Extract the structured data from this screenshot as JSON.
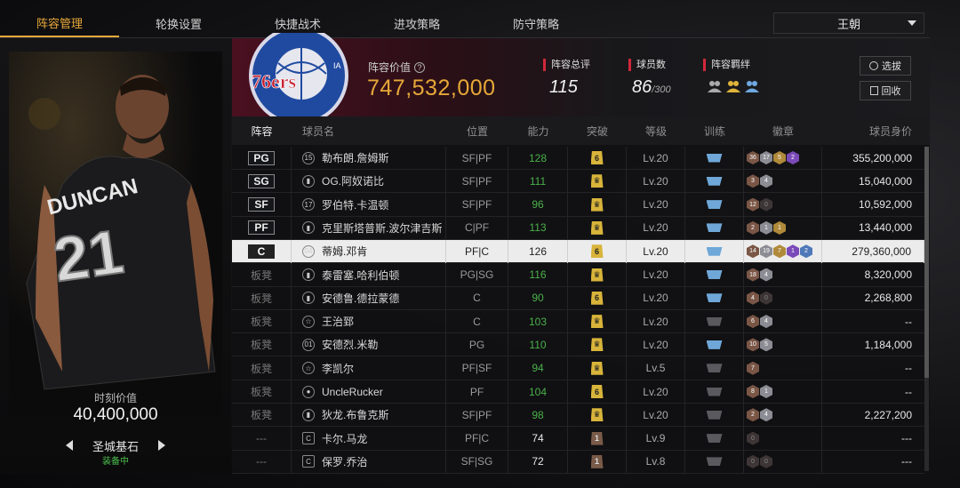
{
  "tabs": [
    {
      "label": "阵容管理",
      "active": true
    },
    {
      "label": "轮换设置",
      "active": false
    },
    {
      "label": "快捷战术",
      "active": false
    },
    {
      "label": "进攻策略",
      "active": false
    },
    {
      "label": "防守策略",
      "active": false
    }
  ],
  "team_select": {
    "value": "王朝"
  },
  "player_card": {
    "moment_label": "时刻价值",
    "moment_value": "40,400,000",
    "card_name": "圣城基石",
    "equipped": "装备中"
  },
  "summary": {
    "lineup_value_label": "阵容价值",
    "lineup_value": "747,532,000",
    "rating_label": "阵容总评",
    "rating": "115",
    "player_count_label": "球员数",
    "player_count": "86",
    "player_count_max": "/300",
    "bond_label": "阵容羁绊",
    "select_button": "选拔",
    "recycle_button": "回收"
  },
  "table": {
    "headers": [
      "阵容",
      "球员名",
      "位置",
      "能力",
      "突破",
      "等级",
      "训练",
      "徽章",
      "球员身价"
    ],
    "rows": [
      {
        "slot": "PG",
        "icon": "15",
        "name": "勒布朗.詹姆斯",
        "position": "SF|PF",
        "ability": "128",
        "break": "6",
        "level": "Lv.20",
        "badges": [
          "36",
          "17",
          "5",
          "2"
        ],
        "value": "355,200,000"
      },
      {
        "slot": "SG",
        "icon": "bars",
        "name": "OG.阿奴诺比",
        "position": "SF|PF",
        "ability": "111",
        "break": "crown",
        "level": "Lv.20",
        "badges": [
          "3",
          "4"
        ],
        "value": "15,040,000"
      },
      {
        "slot": "SF",
        "icon": "17",
        "name": "罗伯特.卡温顿",
        "position": "SF|PF",
        "ability": "96",
        "break": "crown",
        "level": "Lv.20",
        "badges": [
          "12",
          "0"
        ],
        "value": "10,592,000"
      },
      {
        "slot": "PF",
        "icon": "bars",
        "name": "克里斯塔普斯.波尔津吉斯",
        "position": "C|PF",
        "ability": "113",
        "break": "crown",
        "level": "Lv.20",
        "badges": [
          "2",
          "1",
          "1"
        ],
        "value": "13,440,000"
      },
      {
        "slot": "C",
        "icon": "04",
        "name": "蒂姆.邓肯",
        "position": "PF|C",
        "ability": "126",
        "break": "6",
        "level": "Lv.20",
        "badges": [
          "14",
          "19",
          "7",
          "1",
          "2"
        ],
        "value": "279,360,000"
      },
      {
        "slot": "板凳",
        "icon": "bars",
        "name": "泰雷塞.哈利伯顿",
        "position": "PG|SG",
        "ability": "116",
        "break": "crown",
        "level": "Lv.20",
        "badges": [
          "18",
          "4"
        ],
        "value": "8,320,000"
      },
      {
        "slot": "板凳",
        "icon": "bars",
        "name": "安德鲁.德拉蒙德",
        "position": "C",
        "ability": "90",
        "break": "6",
        "level": "Lv.20",
        "badges": [
          "4",
          "0"
        ],
        "value": "2,268,800"
      },
      {
        "slot": "板凳",
        "icon": "star",
        "name": "王治郅",
        "position": "C",
        "ability": "103",
        "break": "crown",
        "level": "Lv.20",
        "badges": [
          "6",
          "4"
        ],
        "value": "--"
      },
      {
        "slot": "板凳",
        "icon": "01",
        "name": "安德烈.米勒",
        "position": "PG",
        "ability": "110",
        "break": "crown",
        "level": "Lv.20",
        "badges": [
          "10",
          "5"
        ],
        "value": "1,184,000"
      },
      {
        "slot": "板凳",
        "icon": "star",
        "name": "李凯尔",
        "position": "PF|SF",
        "ability": "94",
        "break": "crown",
        "level": "Lv.5",
        "badges": [
          "7"
        ],
        "value": "--"
      },
      {
        "slot": "板凳",
        "icon": "person",
        "name": "UncleRucker",
        "position": "PF",
        "ability": "104",
        "break": "6",
        "level": "Lv.20",
        "badges": [
          "8",
          "1"
        ],
        "value": "--"
      },
      {
        "slot": "板凳",
        "icon": "bars",
        "name": "狄龙.布鲁克斯",
        "position": "SF|PF",
        "ability": "98",
        "break": "crown",
        "level": "Lv.20",
        "badges": [
          "2",
          "4"
        ],
        "value": "2,227,200"
      },
      {
        "slot": "---",
        "icon": "COPY",
        "name": "卡尔.马龙",
        "position": "PF|C",
        "ability": "74",
        "break": "1",
        "level": "Lv.9",
        "badges": [
          "0"
        ],
        "value": "---"
      },
      {
        "slot": "---",
        "icon": "COPY",
        "name": "保罗.乔治",
        "position": "SF|SG",
        "ability": "72",
        "break": "1",
        "level": "Lv.8",
        "badges": [
          "0",
          "0"
        ],
        "value": "---"
      }
    ]
  },
  "colors": {
    "accent": "#e8a93a",
    "highlight_red": "#d0283a",
    "ability_green": "#4ab04a",
    "equipped_green": "#4cc24c"
  }
}
